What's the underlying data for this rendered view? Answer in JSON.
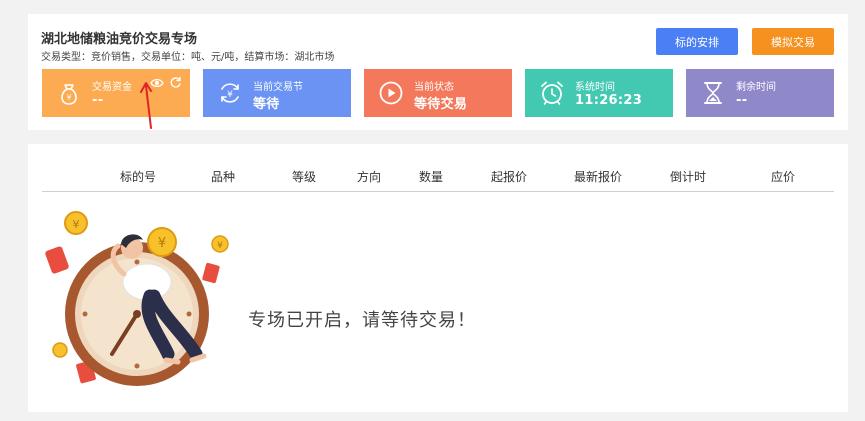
{
  "header": {
    "title": "湖北地储粮油竞价交易专场",
    "trade_info": "交易类型：竞价销售，交易单位：吨、元/吨，结算市场：湖北市场"
  },
  "buttons": {
    "arrange_label": "标的安排",
    "simulate_label": "模拟交易"
  },
  "cards": {
    "funds": {
      "label": "交易资金",
      "value": "--",
      "icon": "money-bag-icon"
    },
    "session": {
      "label": "当前交易节",
      "value": "等待",
      "icon": "yuan-cycle-icon"
    },
    "status": {
      "label": "当前状态",
      "value": "等待交易",
      "icon": "play-icon"
    },
    "time": {
      "label": "系统时间",
      "value": "11:26:23",
      "icon": "alarm-clock-icon"
    },
    "remaining": {
      "label": "剩余时间",
      "value": "--",
      "icon": "hourglass-icon"
    }
  },
  "colors": {
    "funds": "#fdab52",
    "session": "#6b93f3",
    "status": "#f4785b",
    "time": "#43c9b2",
    "remaining": "#8f88c9",
    "arrange": "#4a7ff5",
    "simulate": "#f6901e",
    "annotation_arrow": "#e02424"
  },
  "table": {
    "columns": [
      "标的号",
      "品种",
      "等级",
      "方向",
      "数量",
      "起报价",
      "最新报价",
      "倒计时",
      "应价"
    ]
  },
  "empty_state": {
    "message": "专场已开启，请等待交易！"
  }
}
